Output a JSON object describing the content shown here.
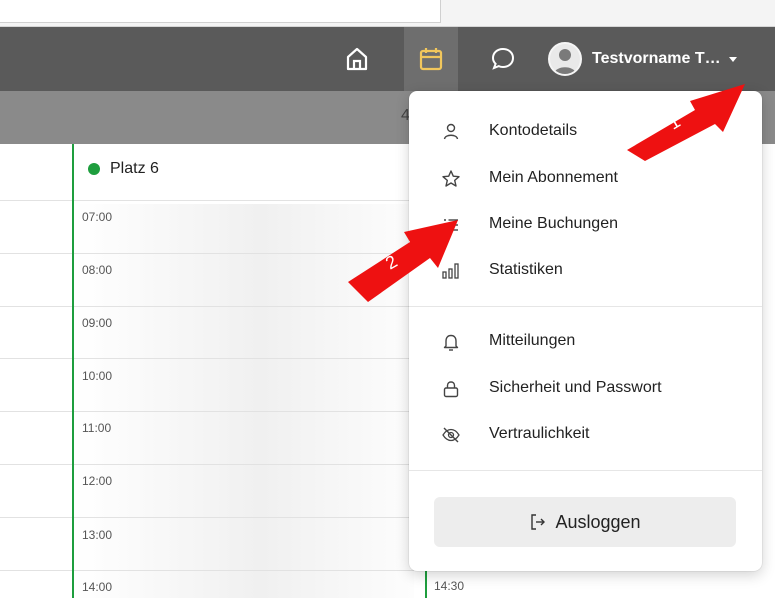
{
  "navbar": {
    "user_name": "Testvorname T…"
  },
  "subheader": {
    "partial_text": "4"
  },
  "calendar": {
    "court_name": "Platz 6",
    "court_color": "#1e9e3e",
    "times": [
      "07:00",
      "08:00",
      "09:00",
      "10:00",
      "11:00",
      "12:00",
      "13:00",
      "14:00"
    ],
    "second_column_time": "14:30"
  },
  "user_menu": {
    "items": [
      {
        "label": "Kontodetails",
        "icon": "person-icon"
      },
      {
        "label": "Mein Abonnement",
        "icon": "star-icon"
      },
      {
        "label": "Meine Buchungen",
        "icon": "list-icon"
      },
      {
        "label": "Statistiken",
        "icon": "bar-chart-icon"
      },
      {
        "label": "Mitteilungen",
        "icon": "bell-icon"
      },
      {
        "label": "Sicherheit und Passwort",
        "icon": "lock-icon"
      },
      {
        "label": "Vertraulichkeit",
        "icon": "eye-off-icon"
      }
    ],
    "logout_label": "Ausloggen"
  },
  "annotations": {
    "arrow1_label": "1",
    "arrow2_label": "2",
    "arrow_color": "#ee1111"
  },
  "colors": {
    "navbar_bg": "#5a5a5a",
    "calendar_icon_accent": "#f2c75c"
  }
}
